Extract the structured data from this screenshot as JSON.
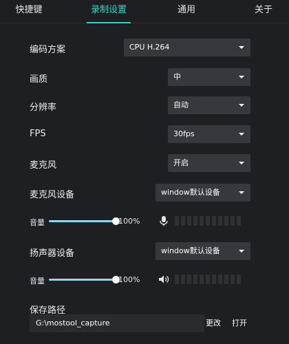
{
  "tabs": [
    {
      "label": "快捷键"
    },
    {
      "label": "录制设置"
    },
    {
      "label": "通用"
    },
    {
      "label": "关于"
    }
  ],
  "settings": {
    "encoding": {
      "label": "编码方案",
      "value": "CPU H.264"
    },
    "quality": {
      "label": "画质",
      "value": "中"
    },
    "resolution": {
      "label": "分辨率",
      "value": "自动"
    },
    "fps": {
      "label": "FPS",
      "value": "30fps"
    },
    "microphone": {
      "label": "麦克风",
      "value": "开启"
    },
    "mic_device": {
      "label": "麦克风设备",
      "value": "window默认设备"
    },
    "mic_volume": {
      "label": "音量",
      "value": "100%",
      "level": 1.0
    },
    "speaker_device": {
      "label": "扬声器设备",
      "value": "window默认设备"
    },
    "speaker_volume": {
      "label": "音量",
      "value": "100%",
      "level": 1.0
    },
    "save_path": {
      "label": "保存路径",
      "value": "G:\\mostool_capture",
      "change_label": "更改",
      "open_label": "打开"
    }
  },
  "colors": {
    "accent": "#2fd6c6",
    "background": "#1e1f22",
    "control": "#37383d",
    "slider": "#8fd8f0"
  }
}
